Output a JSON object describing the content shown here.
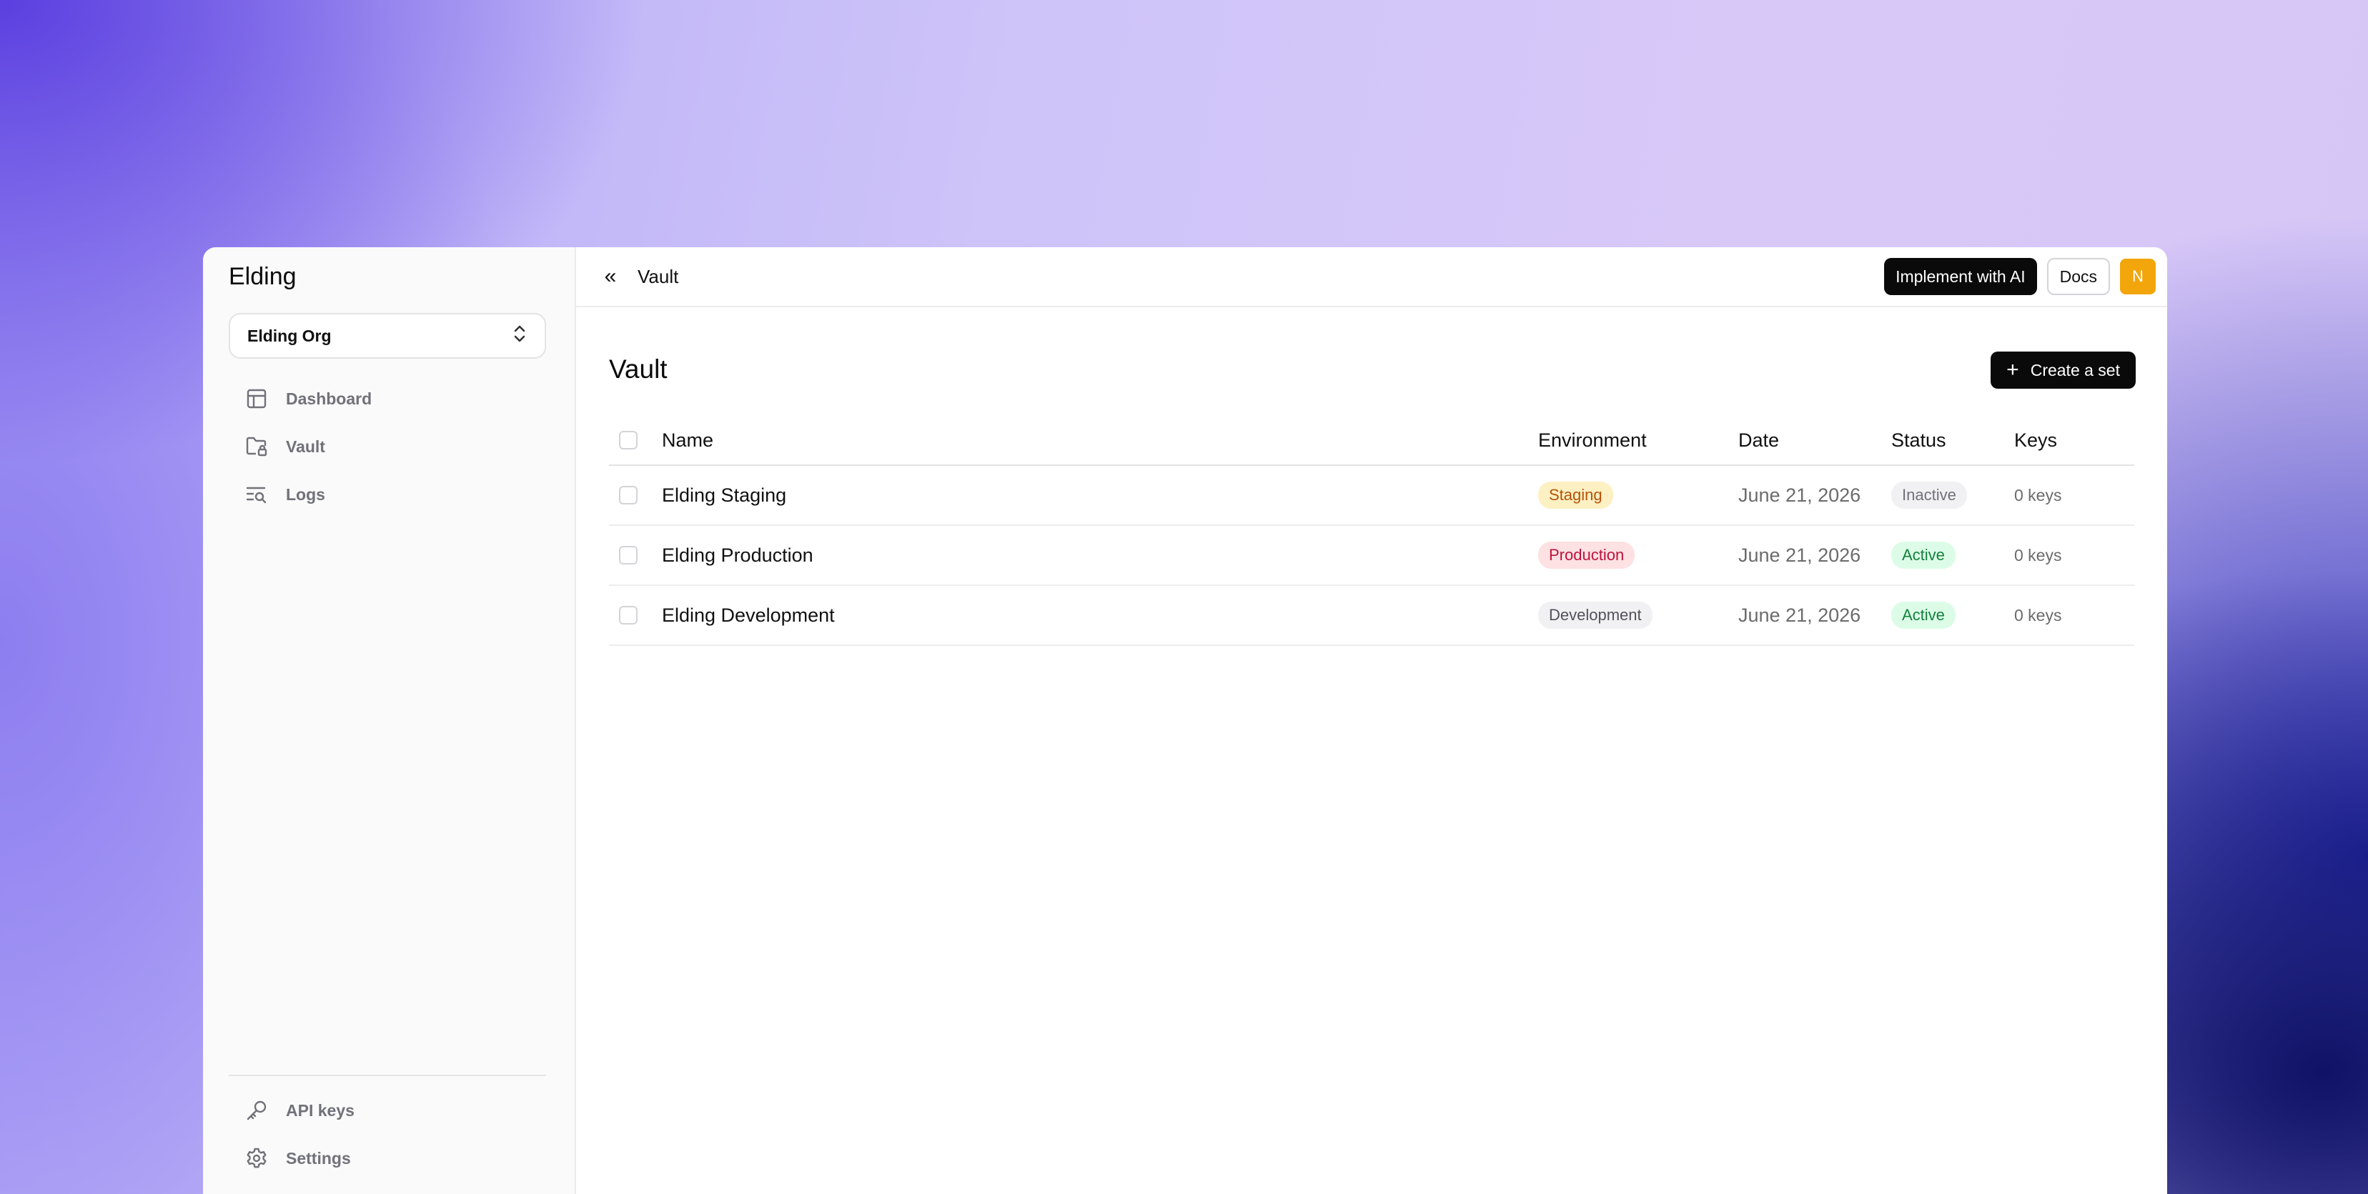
{
  "sidebar": {
    "brand": "Elding",
    "org_select": {
      "value": "Elding Org"
    },
    "nav_items": [
      {
        "label": "Dashboard",
        "icon": "layout-icon"
      },
      {
        "label": "Vault",
        "icon": "folder-lock-icon"
      },
      {
        "label": "Logs",
        "icon": "list-search-icon"
      }
    ],
    "bottom_items": [
      {
        "label": "API keys",
        "icon": "key-icon"
      },
      {
        "label": "Settings",
        "icon": "gear-icon"
      }
    ]
  },
  "topbar": {
    "collapse_glyph": "«",
    "breadcrumb": "Vault",
    "implement_label": "Implement with AI",
    "docs_label": "Docs",
    "avatar_initial": "N",
    "avatar_color": "#f2a60c"
  },
  "main": {
    "title": "Vault",
    "create_label": "Create a set",
    "table": {
      "columns": {
        "name": "Name",
        "environment": "Environment",
        "date": "Date",
        "status": "Status",
        "keys": "Keys"
      },
      "rows": [
        {
          "name": "Elding Staging",
          "environment": "Staging",
          "date": "June 21, 2026",
          "status": "Inactive",
          "keys": "0 keys"
        },
        {
          "name": "Elding Production",
          "environment": "Production",
          "date": "June 21, 2026",
          "status": "Active",
          "keys": "0 keys"
        },
        {
          "name": "Elding Development",
          "environment": "Development",
          "date": "June 21, 2026",
          "status": "Active",
          "keys": "0 keys"
        }
      ]
    }
  },
  "colors": {
    "staging_bg": "#fdf0c2",
    "staging_fg": "#b45309",
    "production_bg": "#fde1e3",
    "production_fg": "#be123c",
    "development_bg": "#f1f1f3",
    "development_fg": "#52525b",
    "active_bg": "#dcfce7",
    "active_fg": "#15803d",
    "inactive_bg": "#f1f1f3",
    "inactive_fg": "#71717a"
  }
}
